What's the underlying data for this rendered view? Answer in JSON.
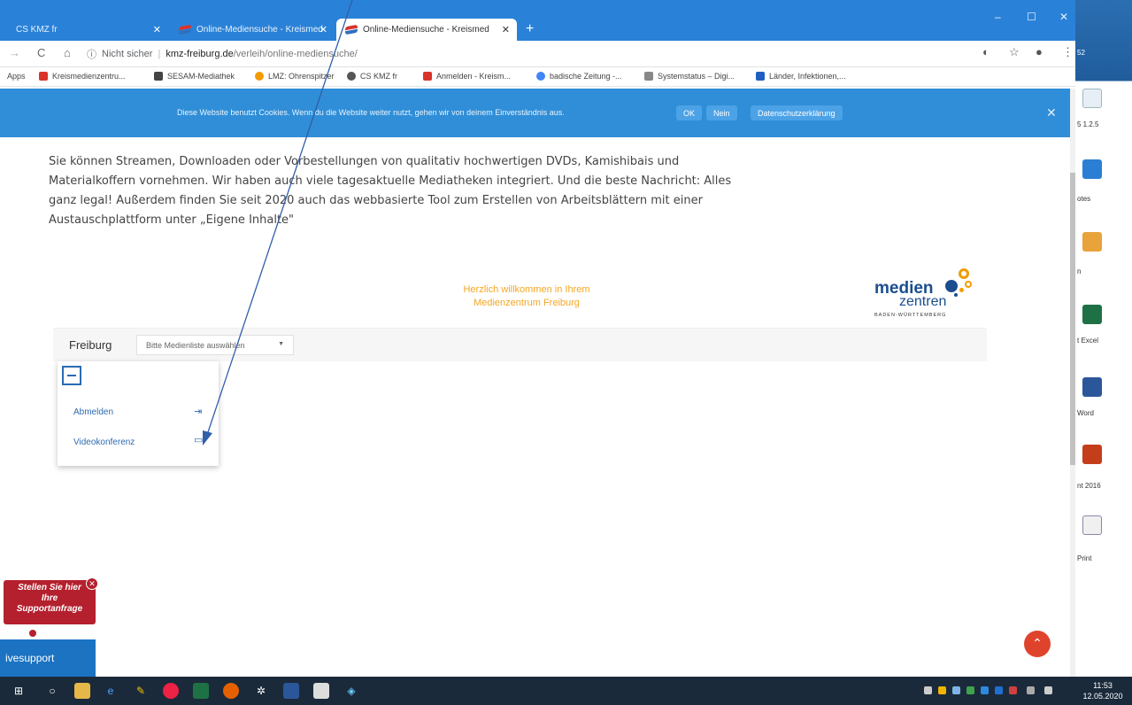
{
  "tabs": [
    {
      "title": "CS KMZ fr"
    },
    {
      "title": "Online-Mediensuche - Kreismed"
    },
    {
      "title": "Online-Mediensuche - Kreismed"
    }
  ],
  "window_controls": {
    "minimize": "–",
    "maximize": "☐",
    "close": "✕"
  },
  "address": {
    "security": "Nicht sicher",
    "domain": "kmz-freiburg.de",
    "path": "/verleih/online-mediensuche/"
  },
  "bookmarks": [
    {
      "label": "Apps",
      "color": "#5f6368"
    },
    {
      "label": "Kreismedienzentru...",
      "color": "#d9342b"
    },
    {
      "label": "SESAM-Mediathek",
      "color": "#444444"
    },
    {
      "label": "LMZ: Ohrenspitzer",
      "color": "#f29b00"
    },
    {
      "label": "CS KMZ fr",
      "color": "#555555"
    },
    {
      "label": "Anmelden - Kreism...",
      "color": "#d9342b"
    },
    {
      "label": "badische Zeitung -...",
      "color": "#4285f4"
    },
    {
      "label": "Systemstatus – Digi...",
      "color": "#888888"
    },
    {
      "label": "Länder, Infektionen,...",
      "color": "#1f5fbf"
    }
  ],
  "cookie": {
    "text": "Diese Website benutzt Cookies. Wenn du die Website weiter nutzt, gehen wir von deinem Einverständnis aus.",
    "ok": "OK",
    "no": "Nein",
    "privacy": "Datenschutzerklärung",
    "close": "✕"
  },
  "intro": {
    "line1": "Sie können Streamen, Downloaden oder Vorbestellungen von qualitativ hochwertigen DVDs, Kamishibais und",
    "line2": "Materialkoffern vornehmen. Wir haben auch viele tagesaktuelle Mediatheken integriert. Und die beste Nachricht: Alles",
    "line3": "ganz legal! Außerdem finden Sie seit 2020 auch das webbasierte Tool zum Erstellen von Arbeitsblättern mit einer",
    "line4": "Austauschplattform unter „Eigene Inhalte\""
  },
  "welcome": {
    "line1": "Herzlich willkommen in Ihrem",
    "line2": "Medienzentrum Freiburg"
  },
  "logo": {
    "word1": "medien",
    "word2": "zentren",
    "region": "BADEN-WÜRTTEMBERG",
    "colors": {
      "blue": "#1a4d8f",
      "orange": "#f29b00"
    }
  },
  "filter": {
    "city": "Freiburg",
    "select": "Bitte Medienliste auswählen"
  },
  "menu": {
    "logout": "Abmelden",
    "video": "Videokonferenz"
  },
  "support": {
    "line1": "Stellen Sie hier",
    "line2": "Ihre",
    "line3": "Supportanfrage",
    "close": "✕",
    "live": "ivesupport"
  },
  "desktop_labels": [
    "52",
    "5 1.2.5",
    "otes",
    "n",
    "t Excel",
    "Word",
    "nt 2016",
    "Print"
  ],
  "clock": {
    "time": "11:53",
    "date": "12.05.2020"
  },
  "accent": "#2f8ed7"
}
